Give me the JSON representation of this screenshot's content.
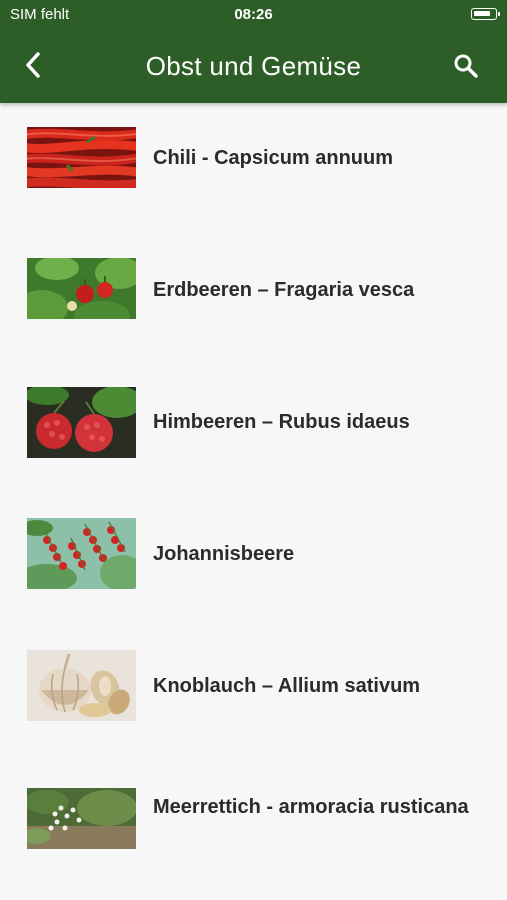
{
  "status_bar": {
    "carrier": "SIM fehlt",
    "time": "08:26"
  },
  "nav": {
    "title": "Obst und Gemüse",
    "back_icon": "chevron-left-icon",
    "search_icon": "search-icon"
  },
  "colors": {
    "header": "#2d5e27",
    "background": "#f7f7f7",
    "text": "#2b2b2b"
  },
  "items": [
    {
      "label": "Chili - Capsicum annuum"
    },
    {
      "label": "Erdbeeren – Fragaria vesca"
    },
    {
      "label": "Himbeeren – Rubus idaeus"
    },
    {
      "label": "Johannisbeere"
    },
    {
      "label": "Knoblauch – Allium sativum"
    },
    {
      "label": "Meerrettich  - armoracia rusticana"
    }
  ]
}
